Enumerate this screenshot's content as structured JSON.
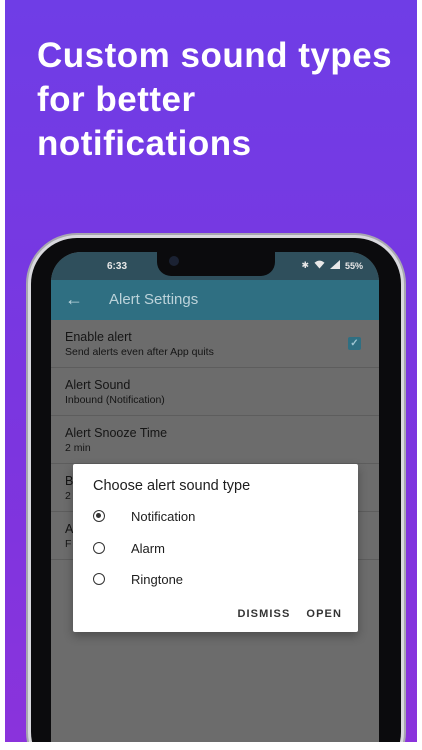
{
  "promo": {
    "headline": "Custom sound types for better notifications"
  },
  "status_bar": {
    "time": "6:33",
    "battery": "55%",
    "icons": [
      "bluetooth-icon",
      "wifi-icon",
      "signal-icon"
    ]
  },
  "app_bar": {
    "back_icon": "arrow-back-icon",
    "title": "Alert Settings"
  },
  "settings": [
    {
      "title": "Enable alert",
      "subtitle": "Send alerts even after App quits",
      "checked": true
    },
    {
      "title": "Alert Sound",
      "subtitle": "Inbound (Notification)"
    },
    {
      "title": "Alert Snooze Time",
      "subtitle": "2 min"
    },
    {
      "title": "B",
      "subtitle": "2"
    },
    {
      "title": "A",
      "subtitle": "F"
    }
  ],
  "dialog": {
    "title": "Choose alert sound type",
    "options": [
      {
        "label": "Notification",
        "selected": true
      },
      {
        "label": "Alarm",
        "selected": false
      },
      {
        "label": "Ringtone",
        "selected": false
      }
    ],
    "dismiss_label": "DISMISS",
    "open_label": "OPEN"
  },
  "colors": {
    "promo_bg": "#7038e2",
    "app_bar": "#2f6f82",
    "dialog_bg": "#ffffff"
  }
}
